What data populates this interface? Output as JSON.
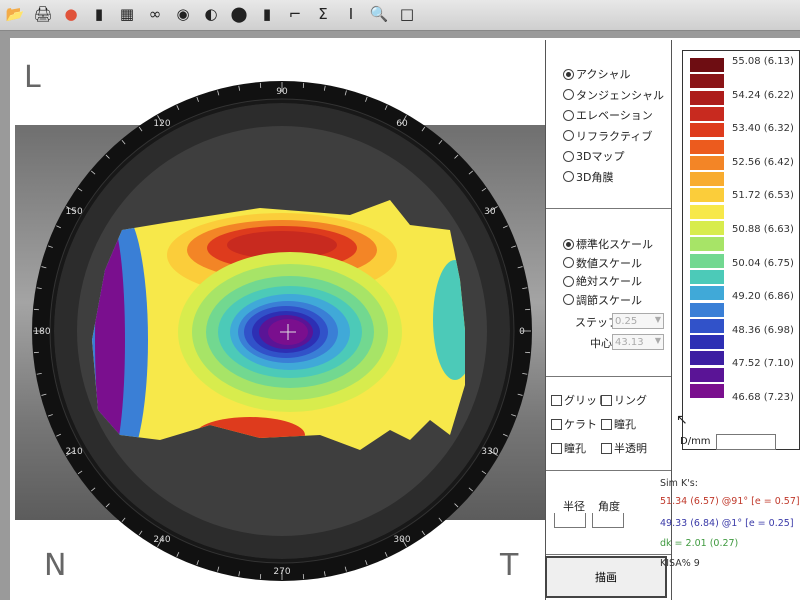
{
  "toolbar": {
    "icons": [
      "folder-icon",
      "printer-icon",
      "color-map-icon",
      "bar-icon",
      "grid-icon",
      "rings-icon",
      "eye-icon",
      "contrast-icon",
      "circle-icon",
      "ruler-icon",
      "angle-icon",
      "sigma-icon",
      "cursor-icon",
      "zoom-icon",
      "window-icon"
    ]
  },
  "map": {
    "corner_tl": "L",
    "corner_bl": "N",
    "corner_br": "T",
    "degrees": [
      {
        "deg": 90,
        "label": "90"
      },
      {
        "deg": 120,
        "label": "120"
      },
      {
        "deg": 60,
        "label": "60"
      },
      {
        "deg": 150,
        "label": "150"
      },
      {
        "deg": 30,
        "label": "30"
      },
      {
        "deg": 180,
        "label": "180"
      },
      {
        "deg": 0,
        "label": "0"
      },
      {
        "deg": 210,
        "label": "210"
      },
      {
        "deg": 330,
        "label": "330"
      },
      {
        "deg": 240,
        "label": "240"
      },
      {
        "deg": 300,
        "label": "300"
      },
      {
        "deg": 270,
        "label": "270"
      }
    ]
  },
  "map_type": {
    "options": [
      "アクシャル",
      "タンジェンシャル",
      "エレベーション",
      "リフラクティブ",
      "3Dマップ",
      "3D角膜"
    ],
    "selected": 0
  },
  "scale_type": {
    "options": [
      "標準化スケール",
      "数値スケール",
      "絶対スケール",
      "調節スケール"
    ],
    "selected": 0,
    "step_label": "ステップ",
    "step_value": "0.25",
    "center_label": "中心",
    "center_value": "43.13"
  },
  "overlays": {
    "items": [
      "グリッド",
      "リング",
      "ケラト",
      "瞳孔",
      "瞳孔",
      "半透明"
    ]
  },
  "position": {
    "radius_label": "半径",
    "angle_label": "角度"
  },
  "draw_button": "描画",
  "color_scale": {
    "colors": [
      "#6e0d12",
      "#8a1417",
      "#ad1c1a",
      "#c82a1f",
      "#de3b1d",
      "#ec5b1e",
      "#f38526",
      "#f8ac2f",
      "#fbcd3a",
      "#f7e84a",
      "#d8ec4d",
      "#a7e467",
      "#72d890",
      "#4ccab8",
      "#40a9d8",
      "#3a7fd6",
      "#3152c9",
      "#2d2fb4",
      "#3c1ea2",
      "#5a1496",
      "#7a0f8e"
    ],
    "labels": [
      "55.08 (6.13)",
      "54.24 (6.22)",
      "53.40 (6.32)",
      "52.56 (6.42)",
      "51.72 (6.53)",
      "50.88 (6.63)",
      "50.04 (6.75)",
      "49.20 (6.86)",
      "48.36 (6.98)",
      "47.52 (7.10)",
      "46.68 (7.23)"
    ],
    "unit": "D/mm"
  },
  "simk": {
    "title": "Sim K's:",
    "steep": "51.34 (6.57) @91°   [e = 0.57]",
    "flat": "49.33 (6.84) @1°    [e = 0.25]",
    "dk": "dk = 2.01  (0.27)",
    "kisa": "KISA% 9",
    "colors": {
      "steep": "#c0392b",
      "flat": "#3a3aa8",
      "dk": "#3f9a3f",
      "kisa": "#333333"
    }
  }
}
